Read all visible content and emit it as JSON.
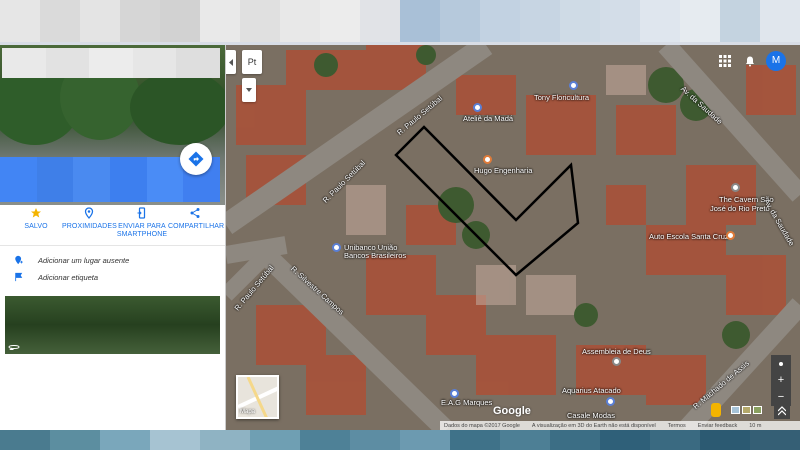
{
  "map": {
    "places": {
      "tony": "Tony Floricultura",
      "atelie": "Ateliê da Madá",
      "hugo": "Hugo Engenharia",
      "cavern": "The Cavern São",
      "cavern2": "José do Rio Preto",
      "autoescola": "Auto Escola Santa Cruz",
      "unibanco": "Unibanco União",
      "unibanco2": "Bancos Brasileiros",
      "assembleia": "Assembleia de Deus",
      "aquarius": "Aquarius Atacado",
      "eag": "E.A.G Marques",
      "casale": "Casale Modas"
    },
    "streets": {
      "paulo1": "R. Paulo Setúbal",
      "paulo2": "R. Paulo Setúbal",
      "paulo3": "R. Paulo Setúbal",
      "silvestre": "R. Silvestre Campos",
      "saudade": "Av. da Saudade",
      "saudade2": "Av. da Saudade",
      "machado": "R. Machado de Assis"
    },
    "lang_label": "Pt",
    "avatar_initial": "M",
    "minimap_label": "Mapa",
    "logo": "Google",
    "zoom_in": "+",
    "zoom_out": "−",
    "footer": {
      "data": "Dados do mapa ©2017 Google",
      "earth": "A visualização em 3D do Earth não está disponível",
      "terms": "Termos",
      "feedback": "Enviar feedback",
      "scale": "10 m"
    }
  },
  "panel": {
    "actions": [
      {
        "label": "SALVO",
        "icon": "star-icon"
      },
      {
        "label": "PROXIMIDADES",
        "icon": "nearby-icon"
      },
      {
        "label": "ENVIAR PARA",
        "label2": "SMARTPHONE",
        "icon": "phone-icon"
      },
      {
        "label": "COMPARTILHAR",
        "icon": "share-icon"
      }
    ],
    "add_place": "Adicionar um lugar ausente",
    "add_label": "Adicionar etiqueta"
  },
  "colors": {
    "accent": "#1a73e8",
    "outline": "#000000"
  }
}
